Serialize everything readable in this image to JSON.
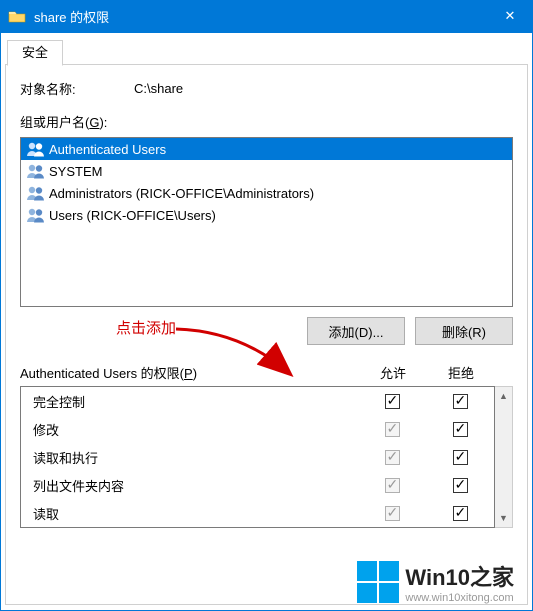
{
  "titlebar": {
    "title": "share 的权限",
    "close_glyph": "✕"
  },
  "tabs": {
    "security": "安全"
  },
  "object": {
    "label": "对象名称:",
    "value": "C:\\share"
  },
  "groups": {
    "label_prefix": "组或用户名(",
    "label_hotkey": "G",
    "label_suffix": "):",
    "items": [
      {
        "name": "Authenticated Users",
        "selected": true
      },
      {
        "name": "SYSTEM",
        "selected": false
      },
      {
        "name": "Administrators (RICK-OFFICE\\Administrators)",
        "selected": false
      },
      {
        "name": "Users (RICK-OFFICE\\Users)",
        "selected": false
      }
    ]
  },
  "annotation": "点击添加",
  "buttons": {
    "add": "添加(D)...",
    "remove": "删除(R)"
  },
  "permissions": {
    "label_prefix": "Authenticated Users 的权限(",
    "label_hotkey": "P",
    "label_suffix": ")",
    "col_allow": "允许",
    "col_deny": "拒绝",
    "rows": [
      {
        "name": "完全控制",
        "allow": "unchecked",
        "deny": "unchecked"
      },
      {
        "name": "修改",
        "allow": "disabled-checked",
        "deny": "unchecked"
      },
      {
        "name": "读取和执行",
        "allow": "disabled-checked",
        "deny": "unchecked"
      },
      {
        "name": "列出文件夹内容",
        "allow": "disabled-checked",
        "deny": "unchecked"
      },
      {
        "name": "读取",
        "allow": "disabled-checked",
        "deny": "unchecked"
      }
    ]
  },
  "watermark": {
    "brand": "Win10之家",
    "url": "www.win10xitong.com"
  }
}
